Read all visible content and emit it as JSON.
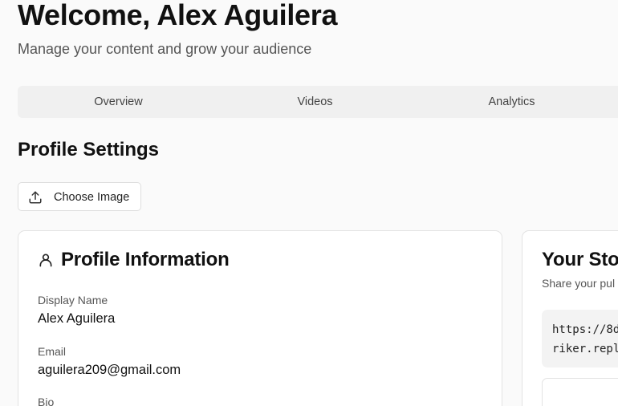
{
  "header": {
    "welcome": "Welcome, Alex Aguilera",
    "subtitle": "Manage your content and grow your audience"
  },
  "tabs": [
    {
      "label": "Overview"
    },
    {
      "label": "Videos"
    },
    {
      "label": "Analytics"
    }
  ],
  "profile_settings": {
    "title": "Profile Settings",
    "choose_image_label": "Choose Image"
  },
  "profile_card": {
    "title": "Profile Information",
    "display_name_label": "Display Name",
    "display_name_value": "Alex Aguilera",
    "email_label": "Email",
    "email_value": "aguilera209@gmail.com",
    "bio_label": "Bio"
  },
  "store_card": {
    "title": "Your Sto",
    "subtitle": "Share your pul",
    "url_line1": "https://8d",
    "url_line2": "riker.repl"
  },
  "icons": {
    "upload": "upload-icon",
    "user": "user-icon"
  }
}
